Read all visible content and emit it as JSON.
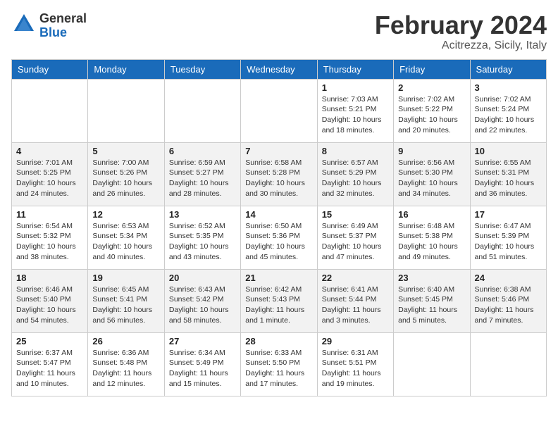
{
  "header": {
    "logo": {
      "general": "General",
      "blue": "Blue"
    },
    "title": "February 2024",
    "location": "Acitrezza, Sicily, Italy"
  },
  "calendar": {
    "days_of_week": [
      "Sunday",
      "Monday",
      "Tuesday",
      "Wednesday",
      "Thursday",
      "Friday",
      "Saturday"
    ],
    "weeks": [
      [
        {
          "day": "",
          "info": ""
        },
        {
          "day": "",
          "info": ""
        },
        {
          "day": "",
          "info": ""
        },
        {
          "day": "",
          "info": ""
        },
        {
          "day": "1",
          "info": "Sunrise: 7:03 AM\nSunset: 5:21 PM\nDaylight: 10 hours\nand 18 minutes."
        },
        {
          "day": "2",
          "info": "Sunrise: 7:02 AM\nSunset: 5:22 PM\nDaylight: 10 hours\nand 20 minutes."
        },
        {
          "day": "3",
          "info": "Sunrise: 7:02 AM\nSunset: 5:24 PM\nDaylight: 10 hours\nand 22 minutes."
        }
      ],
      [
        {
          "day": "4",
          "info": "Sunrise: 7:01 AM\nSunset: 5:25 PM\nDaylight: 10 hours\nand 24 minutes."
        },
        {
          "day": "5",
          "info": "Sunrise: 7:00 AM\nSunset: 5:26 PM\nDaylight: 10 hours\nand 26 minutes."
        },
        {
          "day": "6",
          "info": "Sunrise: 6:59 AM\nSunset: 5:27 PM\nDaylight: 10 hours\nand 28 minutes."
        },
        {
          "day": "7",
          "info": "Sunrise: 6:58 AM\nSunset: 5:28 PM\nDaylight: 10 hours\nand 30 minutes."
        },
        {
          "day": "8",
          "info": "Sunrise: 6:57 AM\nSunset: 5:29 PM\nDaylight: 10 hours\nand 32 minutes."
        },
        {
          "day": "9",
          "info": "Sunrise: 6:56 AM\nSunset: 5:30 PM\nDaylight: 10 hours\nand 34 minutes."
        },
        {
          "day": "10",
          "info": "Sunrise: 6:55 AM\nSunset: 5:31 PM\nDaylight: 10 hours\nand 36 minutes."
        }
      ],
      [
        {
          "day": "11",
          "info": "Sunrise: 6:54 AM\nSunset: 5:32 PM\nDaylight: 10 hours\nand 38 minutes."
        },
        {
          "day": "12",
          "info": "Sunrise: 6:53 AM\nSunset: 5:34 PM\nDaylight: 10 hours\nand 40 minutes."
        },
        {
          "day": "13",
          "info": "Sunrise: 6:52 AM\nSunset: 5:35 PM\nDaylight: 10 hours\nand 43 minutes."
        },
        {
          "day": "14",
          "info": "Sunrise: 6:50 AM\nSunset: 5:36 PM\nDaylight: 10 hours\nand 45 minutes."
        },
        {
          "day": "15",
          "info": "Sunrise: 6:49 AM\nSunset: 5:37 PM\nDaylight: 10 hours\nand 47 minutes."
        },
        {
          "day": "16",
          "info": "Sunrise: 6:48 AM\nSunset: 5:38 PM\nDaylight: 10 hours\nand 49 minutes."
        },
        {
          "day": "17",
          "info": "Sunrise: 6:47 AM\nSunset: 5:39 PM\nDaylight: 10 hours\nand 51 minutes."
        }
      ],
      [
        {
          "day": "18",
          "info": "Sunrise: 6:46 AM\nSunset: 5:40 PM\nDaylight: 10 hours\nand 54 minutes."
        },
        {
          "day": "19",
          "info": "Sunrise: 6:45 AM\nSunset: 5:41 PM\nDaylight: 10 hours\nand 56 minutes."
        },
        {
          "day": "20",
          "info": "Sunrise: 6:43 AM\nSunset: 5:42 PM\nDaylight: 10 hours\nand 58 minutes."
        },
        {
          "day": "21",
          "info": "Sunrise: 6:42 AM\nSunset: 5:43 PM\nDaylight: 11 hours\nand 1 minute."
        },
        {
          "day": "22",
          "info": "Sunrise: 6:41 AM\nSunset: 5:44 PM\nDaylight: 11 hours\nand 3 minutes."
        },
        {
          "day": "23",
          "info": "Sunrise: 6:40 AM\nSunset: 5:45 PM\nDaylight: 11 hours\nand 5 minutes."
        },
        {
          "day": "24",
          "info": "Sunrise: 6:38 AM\nSunset: 5:46 PM\nDaylight: 11 hours\nand 7 minutes."
        }
      ],
      [
        {
          "day": "25",
          "info": "Sunrise: 6:37 AM\nSunset: 5:47 PM\nDaylight: 11 hours\nand 10 minutes."
        },
        {
          "day": "26",
          "info": "Sunrise: 6:36 AM\nSunset: 5:48 PM\nDaylight: 11 hours\nand 12 minutes."
        },
        {
          "day": "27",
          "info": "Sunrise: 6:34 AM\nSunset: 5:49 PM\nDaylight: 11 hours\nand 15 minutes."
        },
        {
          "day": "28",
          "info": "Sunrise: 6:33 AM\nSunset: 5:50 PM\nDaylight: 11 hours\nand 17 minutes."
        },
        {
          "day": "29",
          "info": "Sunrise: 6:31 AM\nSunset: 5:51 PM\nDaylight: 11 hours\nand 19 minutes."
        },
        {
          "day": "",
          "info": ""
        },
        {
          "day": "",
          "info": ""
        }
      ]
    ]
  }
}
